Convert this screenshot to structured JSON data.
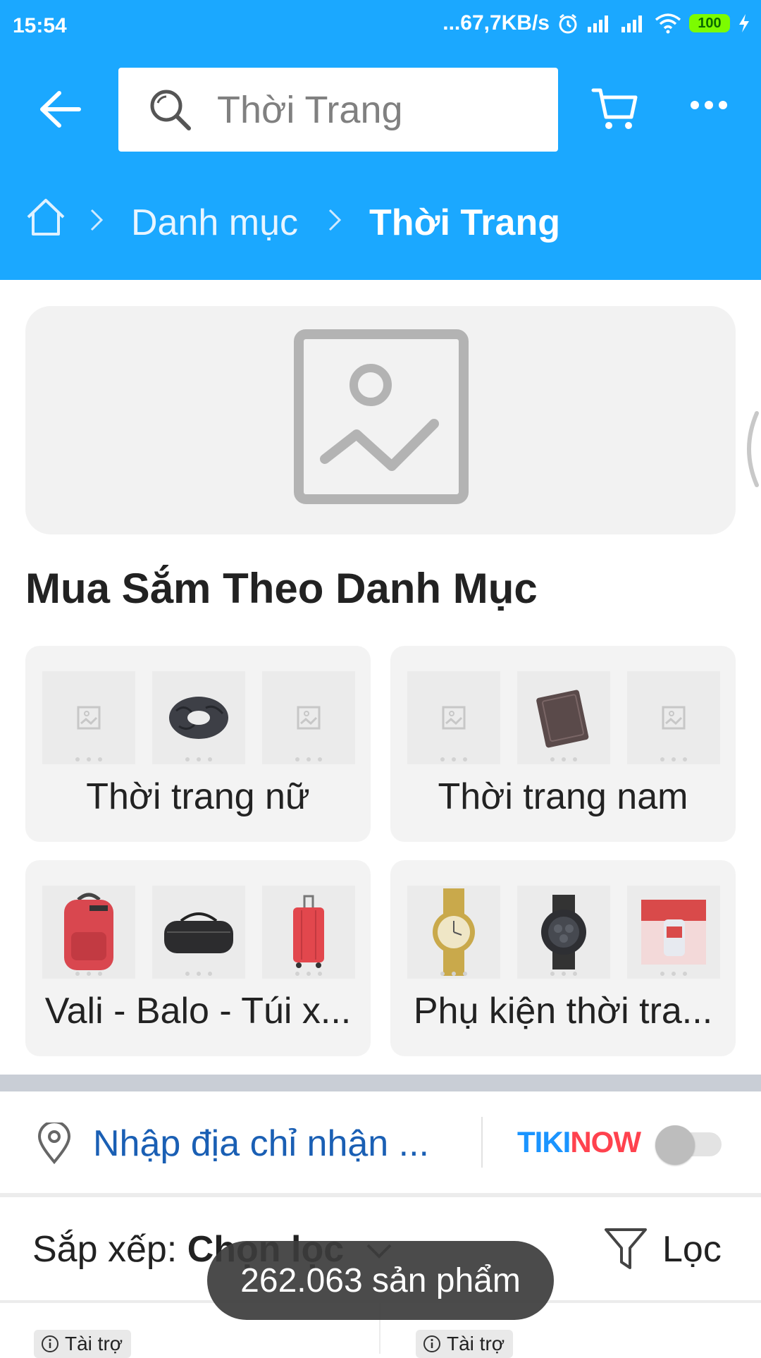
{
  "status_bar": {
    "time": "15:54",
    "network_speed": "...67,7KB/s",
    "battery": "100"
  },
  "header": {
    "search": {
      "placeholder": "Thời Trang"
    }
  },
  "breadcrumb": {
    "items": [
      "Danh mục",
      "Thời Trang"
    ]
  },
  "section": {
    "title": "Mua Sắm Theo Danh Mục"
  },
  "categories": [
    {
      "label": "Thời trang nữ"
    },
    {
      "label": "Thời trang nam"
    },
    {
      "label": "Vali - Balo - Túi x..."
    },
    {
      "label": "Phụ kiện thời tra..."
    }
  ],
  "address": {
    "placeholder": "Nhập địa chỉ nhận ...",
    "tikinow_label": "TIKINOW",
    "tikinow_enabled": false
  },
  "sort": {
    "prefix": "Sắp xếp:",
    "value": "Chọn lọc",
    "filter_label": "Lọc"
  },
  "products": {
    "sponsored_badge": "Tài trợ"
  },
  "toast": {
    "text": "262.063 sản phẩm"
  },
  "colors": {
    "header_blue": "#1BA8FF",
    "address_blue": "#1a5fb4",
    "battery_green": "#7CFC00"
  }
}
